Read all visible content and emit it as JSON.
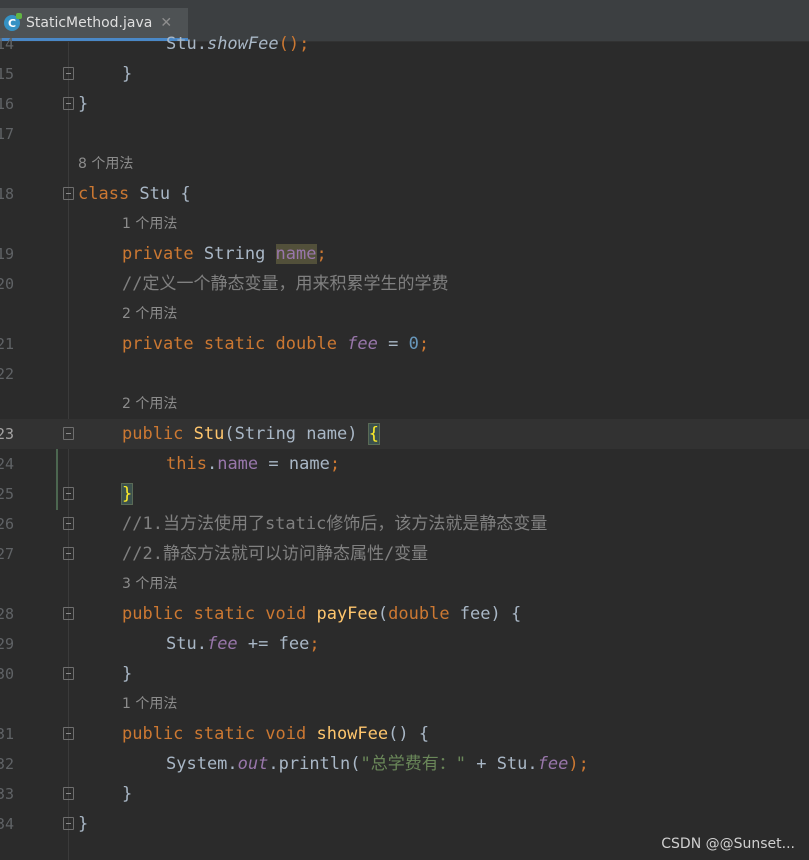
{
  "tab": {
    "title": "StaticMethod.java",
    "close": "✕",
    "icon": "java-class-icon",
    "icon_letter": "C"
  },
  "lines": {
    "l14": {
      "num": "14",
      "t1": "Stu.",
      "t2": "showFee",
      "t3": "();"
    },
    "l15": {
      "num": "15",
      "t1": "}"
    },
    "l16": {
      "num": "16",
      "t1": "}"
    },
    "l17": {
      "num": "17"
    },
    "hint18": "8 个用法",
    "l18": {
      "num": "18",
      "t1": "class",
      "t2": " Stu {"
    },
    "hint19": "1 个用法",
    "l19": {
      "num": "19",
      "t1": "private",
      "t2": " String ",
      "t3": "name",
      "t4": ";"
    },
    "l20": {
      "num": "20",
      "t1": "//定义一个静态变量，用来积累学生的学费"
    },
    "hint21": "2 个用法",
    "l21": {
      "num": "21",
      "t1": "private static double ",
      "t2": "fee",
      "t3": " = ",
      "t4": "0",
      "t5": ";"
    },
    "l22": {
      "num": "22"
    },
    "hint23": "2 个用法",
    "l23": {
      "num": "23",
      "t1": "public",
      "t2": " ",
      "t3": "Stu",
      "t4": "(String name) ",
      "t5": "{"
    },
    "l24": {
      "num": "24",
      "t1": "this",
      "t2": ".",
      "t3": "name",
      "t4": " = name",
      "t5": ";"
    },
    "l25": {
      "num": "25",
      "t1": "}"
    },
    "l26": {
      "num": "26",
      "t1": "//1.当方法使用了static修饰后，该方法就是静态变量"
    },
    "l27": {
      "num": "27",
      "t1": "//2.静态方法就可以访问静态属性/变量"
    },
    "hint28": "3 个用法",
    "l28": {
      "num": "28",
      "t1": "public static void ",
      "t2": "payFee",
      "t3": "(",
      "t4": "double",
      "t5": " fee) {"
    },
    "l29": {
      "num": "29",
      "t1": "Stu.",
      "t2": "fee",
      "t3": " += fee",
      "t4": ";"
    },
    "l30": {
      "num": "30",
      "t1": "}"
    },
    "hint31": "1 个用法",
    "l31": {
      "num": "31",
      "t1": "public static void ",
      "t2": "showFee",
      "t3": "() {"
    },
    "l32": {
      "num": "32",
      "t1": "System.",
      "t2": "out",
      "t3": ".println(",
      "t4": "\"总学费有：\"",
      "t5": " + Stu.",
      "t6": "fee",
      "t7": ");"
    },
    "l33": {
      "num": "33",
      "t1": "}"
    },
    "l34": {
      "num": "34",
      "t1": "}"
    }
  },
  "watermark": "CSDN @@Sunset...",
  "colors": {
    "keyword": "#cc7832",
    "field": "#9876aa",
    "method": "#ffc66d",
    "number": "#6897bb",
    "string": "#6a8759",
    "comment": "#808080",
    "text": "#a9b7c6",
    "background": "#2b2b2b"
  }
}
